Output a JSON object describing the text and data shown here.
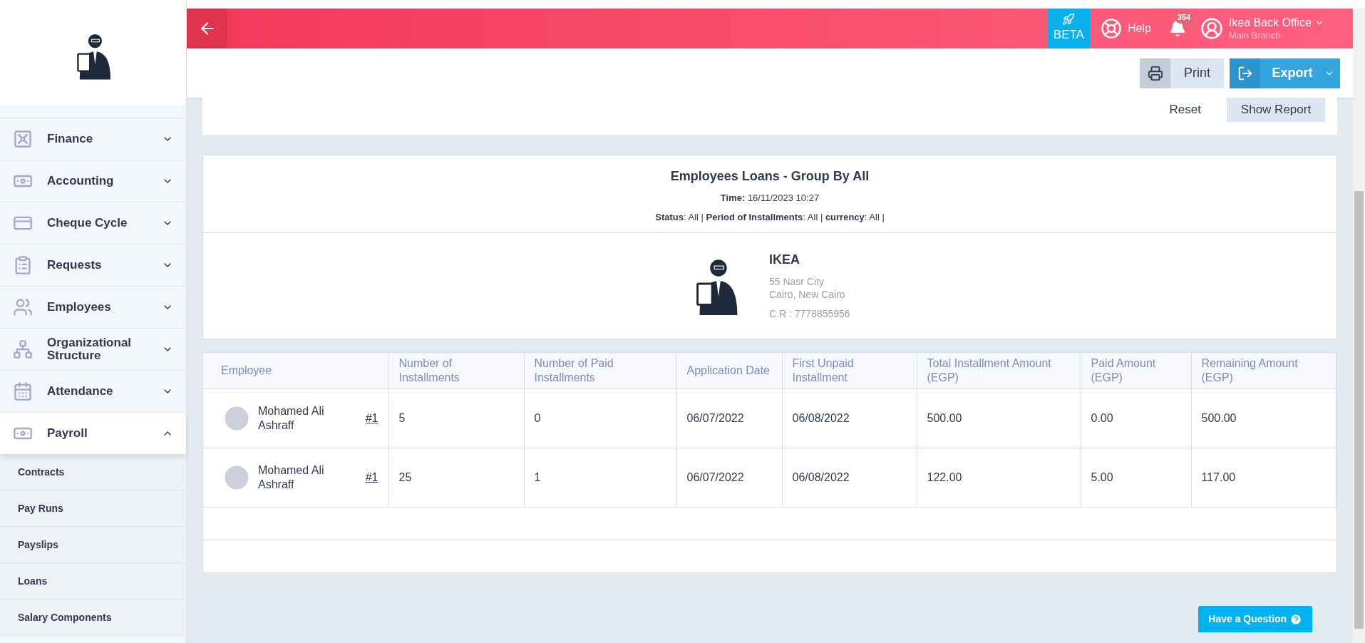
{
  "header": {
    "beta": "BETA",
    "help": "Help",
    "notifications": "354",
    "user": "Ikea Back Office",
    "branch": "Main Branch"
  },
  "toolbar": {
    "print": "Print",
    "export": "Export"
  },
  "filters": {
    "reset": "Reset",
    "show_report": "Show Report"
  },
  "sidebar": {
    "items": [
      {
        "kind": "finance",
        "label": "Finance",
        "expanded": false,
        "selected": false
      },
      {
        "kind": "accounting",
        "label": "Accounting",
        "expanded": false,
        "selected": false
      },
      {
        "kind": "cheque",
        "label": "Cheque Cycle",
        "expanded": false,
        "selected": false
      },
      {
        "kind": "requests",
        "label": "Requests",
        "expanded": false,
        "selected": false
      },
      {
        "kind": "employees",
        "label": "Employees",
        "expanded": false,
        "selected": false
      },
      {
        "kind": "org",
        "label": "Organizational Structure",
        "expanded": false,
        "selected": false
      },
      {
        "kind": "attendance",
        "label": "Attendance",
        "expanded": false,
        "selected": false
      },
      {
        "kind": "payroll",
        "label": "Payroll",
        "expanded": true,
        "selected": true,
        "children": [
          {
            "label": "Contracts"
          },
          {
            "label": "Pay Runs"
          },
          {
            "label": "Payslips"
          },
          {
            "label": "Loans"
          },
          {
            "label": "Salary Components"
          }
        ]
      }
    ]
  },
  "report": {
    "title": "Employees Loans - Group By All",
    "time": "**Time:** 16/11/2023 10:27",
    "criteria": "**Status**: All | **Period of Installments**: All | **currency**: All |"
  },
  "company": {
    "name": "IKEA",
    "address": [
      "55 Nasr City",
      "Cairo, New Cairo"
    ],
    "cr": "C.R : 7778855956"
  },
  "table": {
    "columns": [
      "Employee",
      "Number of Installments",
      "Number of Paid Installments",
      "Application Date",
      "First Unpaid Installment",
      "Total Installment Amount (EGP)",
      "Paid Amount (EGP)",
      "Remaining Amount (EGP)"
    ],
    "rows": [
      {
        "cells": [
          {
            "name": "Mohamed Ali Ashraff",
            "ref": "#1"
          },
          "5",
          "0",
          "06/07/2022",
          "06/08/2022",
          "500.00",
          "0.00",
          "500.00"
        ]
      },
      {
        "cells": [
          {
            "name": "Mohamed Ali Ashraff",
            "ref": "#1"
          },
          "25",
          "1",
          "06/07/2022",
          "06/08/2022",
          "122.00",
          "5.00",
          "117.00"
        ]
      }
    ]
  },
  "help_button": "Have a Question"
}
